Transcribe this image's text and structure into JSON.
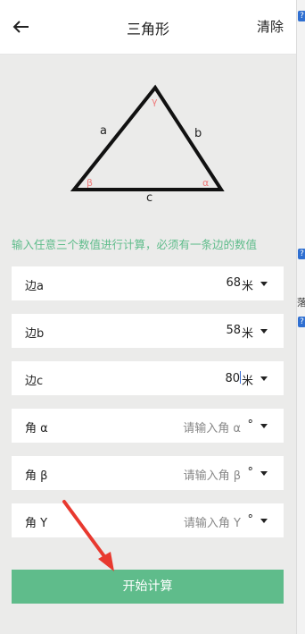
{
  "header": {
    "title": "三角形",
    "clear_label": "清除",
    "back_icon": "arrow-left-icon"
  },
  "diagram": {
    "side_a": "a",
    "side_b": "b",
    "side_c": "c",
    "angle_alpha": "α",
    "angle_beta": "β",
    "angle_gamma": "γ"
  },
  "hint": "输入任意三个数值进行计算，必须有一条边的数值",
  "fields": [
    {
      "label": "边a",
      "value": "68",
      "unit": "米",
      "placeholder": ""
    },
    {
      "label": "边b",
      "value": "58",
      "unit": "米",
      "placeholder": ""
    },
    {
      "label": "边c",
      "value": "80",
      "unit": "米",
      "placeholder": ""
    },
    {
      "label": "角 α",
      "value": "",
      "unit": "°",
      "placeholder": "请输入角 α"
    },
    {
      "label": "角 β",
      "value": "",
      "unit": "°",
      "placeholder": "请输入角 β"
    },
    {
      "label": "角 Y",
      "value": "",
      "unit": "°",
      "placeholder": "请输入角 Y"
    }
  ],
  "start_button": "开始计算",
  "side_strip": {
    "char1": "落"
  },
  "colors": {
    "accent": "#5fbc8b",
    "angle_label": "#ee7b7b",
    "annotation_arrow": "#e8392f"
  }
}
